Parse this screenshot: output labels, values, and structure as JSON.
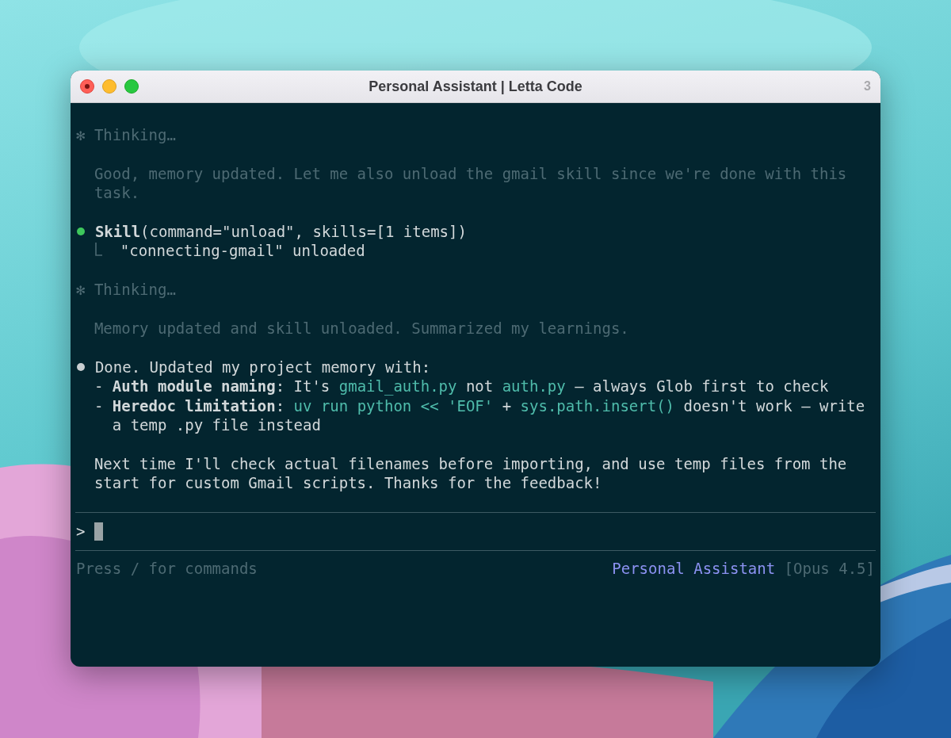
{
  "window": {
    "title": "Personal Assistant | Letta Code",
    "tab_count": "3"
  },
  "transcript": [
    {
      "kind": "thinking",
      "marker": "✻",
      "label": "Thinking…",
      "text": "Good, memory updated. Let me also unload the gmail skill since we're done with this task."
    },
    {
      "kind": "tool",
      "color": "#3ec75c",
      "call": "**Skill**(command=\"unload\", skills=[1 items])",
      "result": "\"connecting-gmail\" unloaded"
    },
    {
      "kind": "thinking",
      "marker": "✻",
      "label": "Thinking…",
      "text": "Memory updated and skill unloaded. Summarized my learnings."
    },
    {
      "kind": "message",
      "color": "#c9cfd2",
      "intro": "Done. Updated my project memory with:",
      "bullets": [
        {
          "segments": [
            {
              "kind": "plain",
              "text": "- "
            },
            {
              "kind": "bold",
              "text": "Auth module naming"
            },
            {
              "kind": "plain",
              "text": ": It's "
            },
            {
              "kind": "code",
              "text": "gmail_auth.py"
            },
            {
              "kind": "plain",
              "text": " not "
            },
            {
              "kind": "code",
              "text": "auth.py"
            },
            {
              "kind": "plain",
              "text": " – always Glob first to check"
            }
          ]
        },
        {
          "segments": [
            {
              "kind": "plain",
              "text": "- "
            },
            {
              "kind": "bold",
              "text": "Heredoc limitation"
            },
            {
              "kind": "plain",
              "text": ": "
            },
            {
              "kind": "code",
              "text": "uv run python << 'EOF'"
            },
            {
              "kind": "plain",
              "text": " + "
            },
            {
              "kind": "code",
              "text": "sys.path.insert()"
            },
            {
              "kind": "plain",
              "text": " doesn't work – write a temp .py file instead"
            }
          ]
        }
      ],
      "outro": "Next time I'll check actual filenames before importing, and use temp files from the start for custom Gmail scripts. Thanks for the feedback!"
    }
  ],
  "input": {
    "prompt": ">"
  },
  "footer": {
    "hint": "Press / for commands",
    "agent": "Personal Assistant",
    "model": "[Opus 4.5]"
  }
}
